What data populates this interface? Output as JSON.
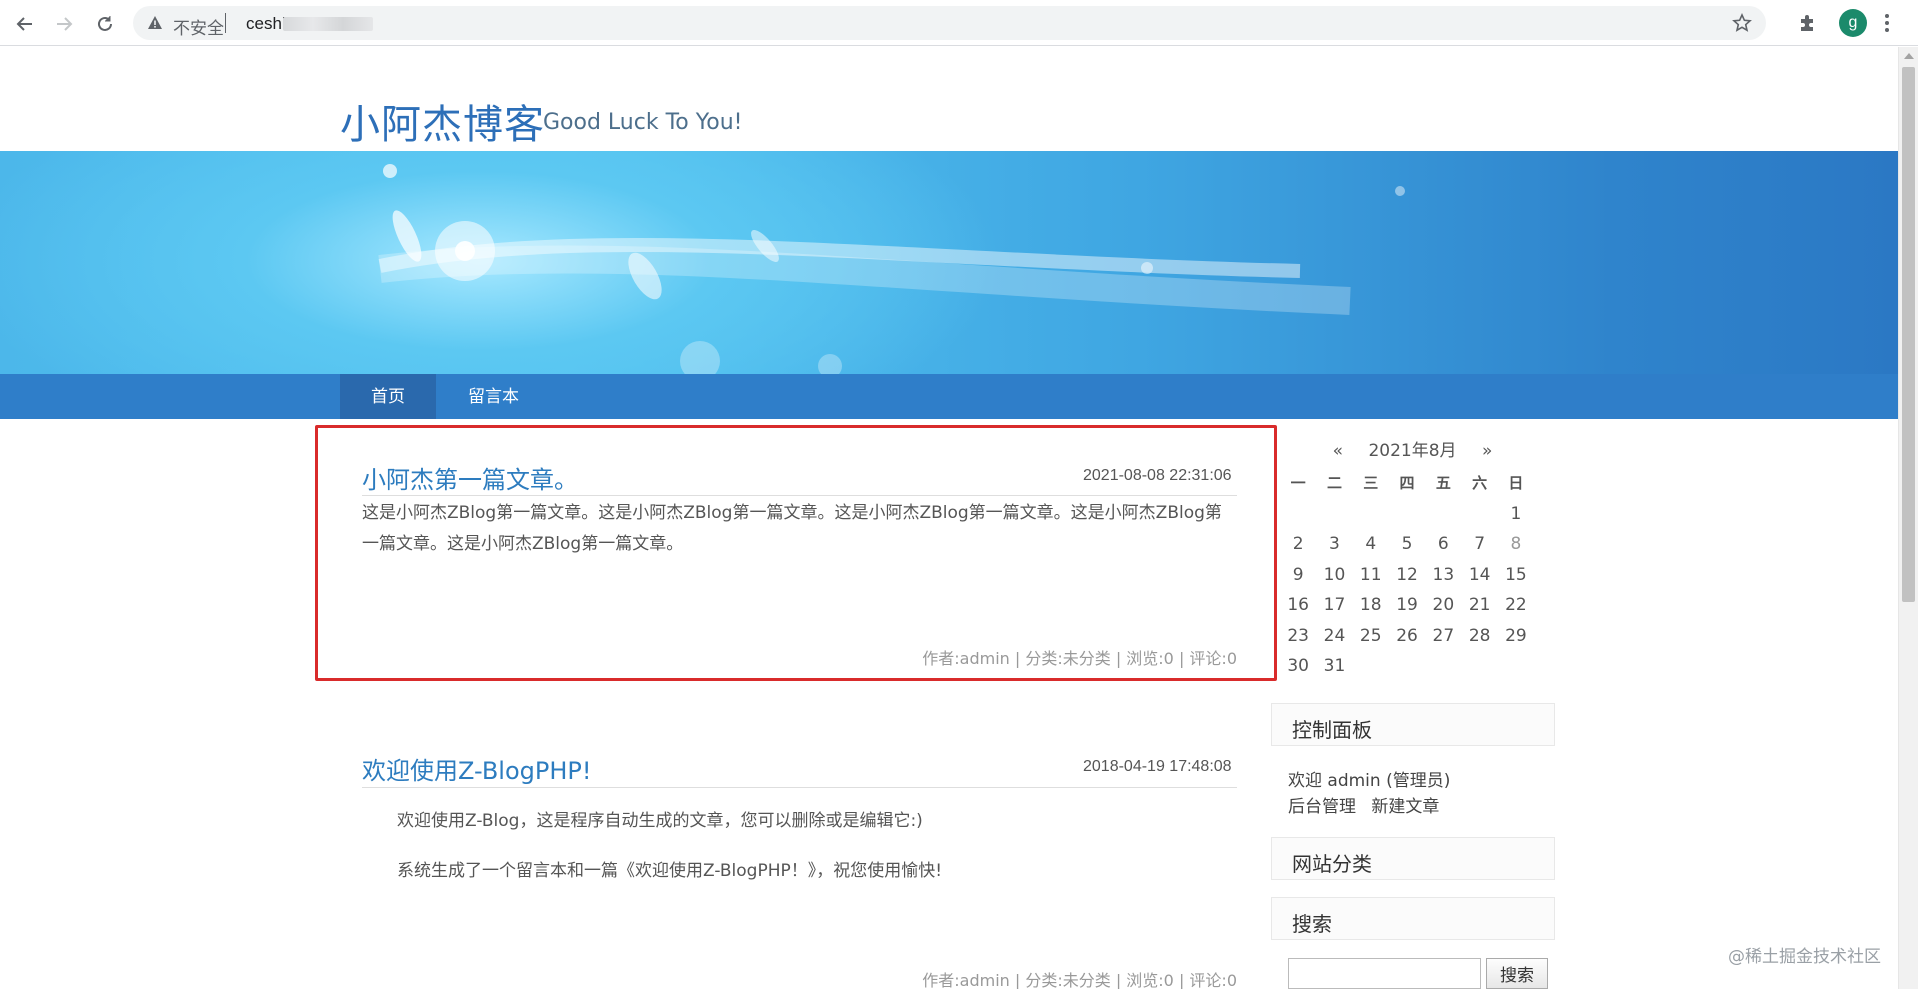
{
  "browser": {
    "security_label": "不安全",
    "url": "ceshi",
    "avatar_letter": "g"
  },
  "site": {
    "title": "小阿杰博客",
    "subtitle": "Good Luck To You!"
  },
  "nav": {
    "items": [
      {
        "label": "首页"
      },
      {
        "label": "留言本"
      }
    ]
  },
  "posts": [
    {
      "title": "小阿杰第一篇文章。",
      "date": "2021-08-08 22:31:06",
      "body_line1": "这是小阿杰ZBlog第一篇文章。这是小阿杰ZBlog第一篇文章。这是小阿杰ZBlog第一篇文章。这是小阿杰ZBlog第",
      "body_line2": "一篇文章。这是小阿杰ZBlog第一篇文章。",
      "meta": "作者:admin | 分类:未分类 | 浏览:0 | 评论:0"
    },
    {
      "title": "欢迎使用Z-BlogPHP!",
      "date": "2018-04-19 17:48:08",
      "para1": "欢迎使用Z-Blog，这是程序自动生成的文章，您可以删除或是编辑它:)",
      "para2": "系统生成了一个留言本和一篇《欢迎使用Z-BlogPHP！》，祝您使用愉快!",
      "meta": "作者:admin | 分类:未分类 | 浏览:0 | 评论:0"
    }
  ],
  "calendar": {
    "prev": "«",
    "month": "2021年8月",
    "next": "»",
    "weekdays": [
      "一",
      "二",
      "三",
      "四",
      "五",
      "六",
      "日"
    ],
    "days": [
      "",
      "",
      "",
      "",
      "",
      "",
      "1",
      "2",
      "3",
      "4",
      "5",
      "6",
      "7",
      "8",
      "9",
      "10",
      "11",
      "12",
      "13",
      "14",
      "15",
      "16",
      "17",
      "18",
      "19",
      "20",
      "21",
      "22",
      "23",
      "24",
      "25",
      "26",
      "27",
      "28",
      "29",
      "30",
      "31",
      "",
      "",
      "",
      "",
      ""
    ],
    "highlight_day": "8"
  },
  "sidebar": {
    "control_panel": {
      "title": "控制面板",
      "welcome": "欢迎 admin (管理员)",
      "admin_link": "后台管理",
      "new_post_link": "新建文章"
    },
    "categories_title": "网站分类",
    "search": {
      "title": "搜索",
      "button": "搜索",
      "value": ""
    }
  },
  "watermark": "@稀土掘金技术社区",
  "colors": {
    "link_blue": "#2d7cbf",
    "nav_blue": "#2f7ec9",
    "nav_active": "#2a69ad",
    "highlight_red": "#d92b2b"
  }
}
